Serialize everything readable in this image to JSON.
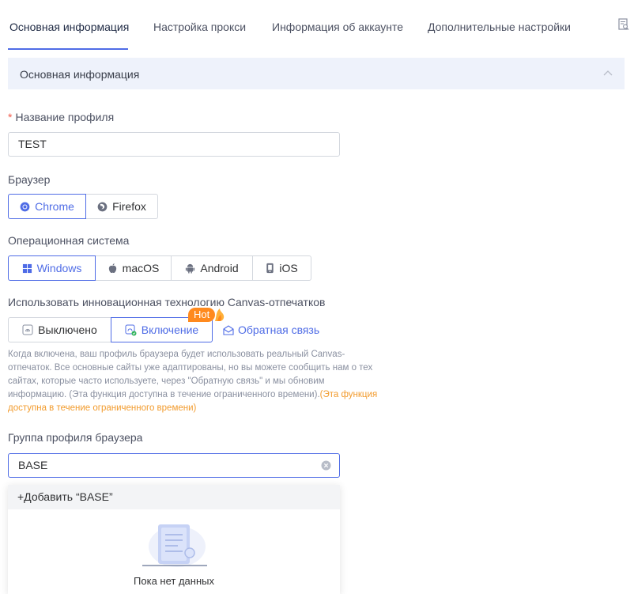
{
  "tabs": [
    {
      "label": "Основная информация",
      "active": true
    },
    {
      "label": "Настройка прокси"
    },
    {
      "label": "Информация об аккаунте"
    },
    {
      "label": "Дополнительные настройки"
    }
  ],
  "section": {
    "title": "Основная информация"
  },
  "profile_name": {
    "required_mark": "*",
    "label": "Название профиля",
    "value": "TEST"
  },
  "browser": {
    "label": "Браузер",
    "options": [
      "Chrome",
      "Firefox"
    ],
    "selected": "Chrome"
  },
  "os": {
    "label": "Операционная система",
    "options": [
      "Windows",
      "macOS",
      "Android",
      "iOS"
    ],
    "selected": "Windows"
  },
  "canvas": {
    "label": "Использовать инновационная технологию Canvas-отпечатков",
    "options": [
      "Выключено",
      "Включение"
    ],
    "selected": "Включение",
    "hot_badge": "Hot",
    "feedback": "Обратная связь",
    "description": "Когда включена, ваш профиль браузера будет использовать реальный Canvas-отпечаток. Все основные сайты уже адаптированы, но вы можете сообщить нам о тех сайтах, которые часто используете, через \"Обратную связь\" и мы обновим информацию. (Эта функция доступна в течение ограниченного времени).",
    "description_highlight": "(Эта функция доступна в течение ограниченного времени)"
  },
  "group": {
    "label": "Группа профиля браузера",
    "value": "BASE",
    "add_option": "+Добавить “BASE”",
    "empty_text": "Пока нет данных"
  },
  "colors": {
    "accent": "#4f6ce6",
    "required": "#f25b4c",
    "hot": "#ff8a1e",
    "highlight": "#f29b2d"
  }
}
